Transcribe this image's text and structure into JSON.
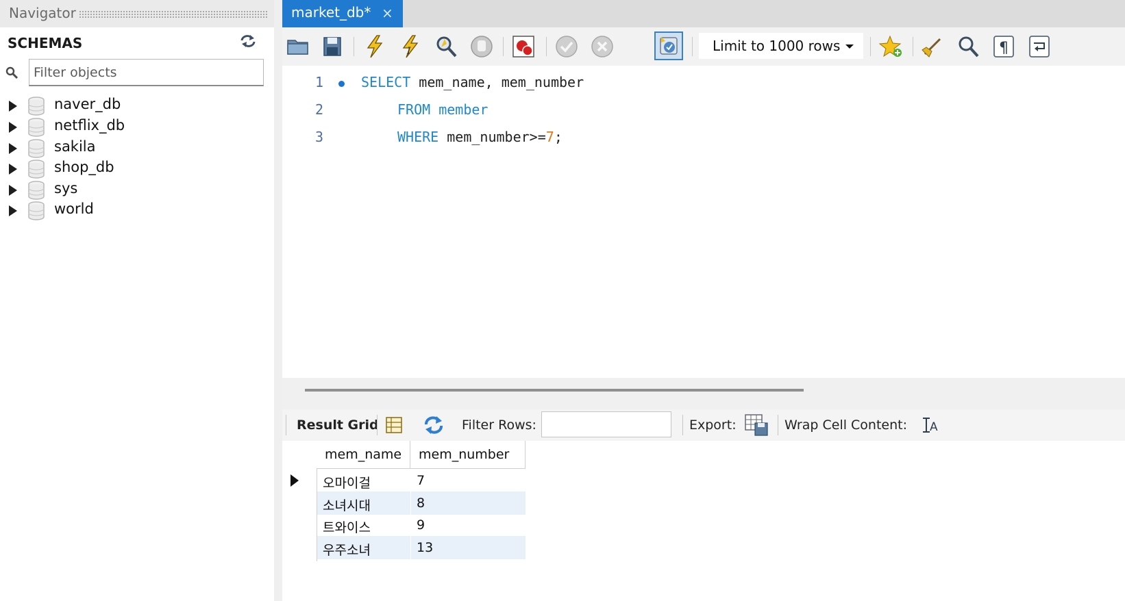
{
  "navigator": {
    "title": "Navigator",
    "schemas_label": "SCHEMAS",
    "filter_placeholder": "Filter objects",
    "schemas": [
      "naver_db",
      "netflix_db",
      "sakila",
      "shop_db",
      "sys",
      "world"
    ]
  },
  "editor_tab": {
    "label": "market_db*",
    "close": "×"
  },
  "toolbar": {
    "limit_label": "Limit to 1000 rows",
    "icons": [
      "open-folder-icon",
      "save-icon",
      "execute-icon",
      "execute-current-icon",
      "explain-icon",
      "stop-icon",
      "toggle-error-icon",
      "commit-icon",
      "rollback-icon",
      "auto-commit-icon",
      "bookmark-icon",
      "beautify-icon",
      "find-icon",
      "invisible-chars-icon",
      "wrap-icon"
    ]
  },
  "sql_lines": [
    {
      "num": "1",
      "parts": [
        {
          "t": "SELECT",
          "c": "kw"
        },
        {
          "t": " mem_name, mem_number",
          "c": "tx"
        }
      ],
      "indent": 0,
      "marker": true
    },
    {
      "num": "2",
      "parts": [
        {
          "t": "FROM member",
          "c": "kw"
        }
      ],
      "indent": 1,
      "marker": false
    },
    {
      "num": "3",
      "parts": [
        {
          "t": "WHERE",
          "c": "kw"
        },
        {
          "t": " mem_number>=",
          "c": "tx"
        },
        {
          "t": "7",
          "c": "num"
        },
        {
          "t": ";",
          "c": "tx"
        }
      ],
      "indent": 1,
      "marker": false
    }
  ],
  "result_toolbar": {
    "result_grid": "Result Grid",
    "filter_rows": "Filter Rows:",
    "filter_value": "",
    "export": "Export:",
    "wrap": "Wrap Cell Content:"
  },
  "result": {
    "columns": [
      "mem_name",
      "mem_number"
    ],
    "rows": [
      [
        "오마이걸",
        "7"
      ],
      [
        "소녀시대",
        "8"
      ],
      [
        "트와이스",
        "9"
      ],
      [
        "우주소녀",
        "13"
      ]
    ]
  }
}
